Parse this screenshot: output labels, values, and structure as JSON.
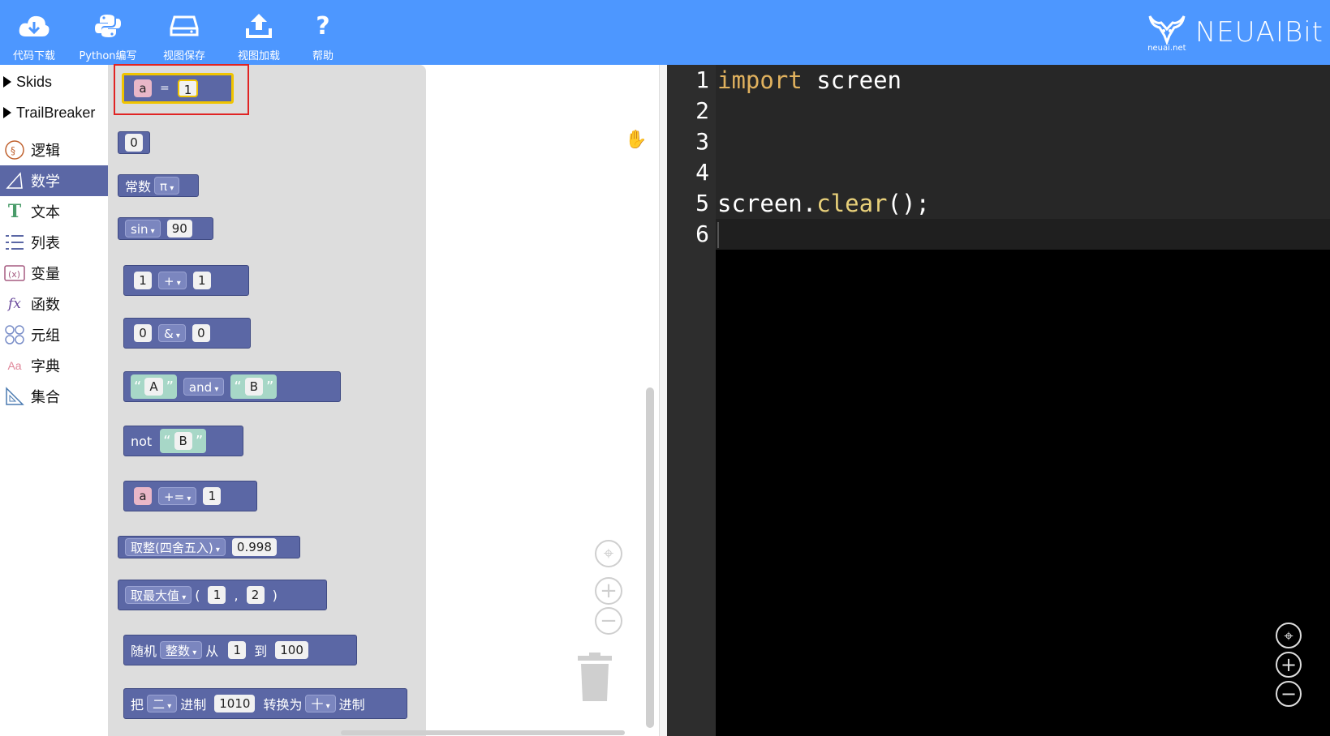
{
  "toolbar": {
    "buttons": [
      {
        "label": "代码下载",
        "icon": "cloud-download-icon"
      },
      {
        "label": "Python编写",
        "icon": "python-icon"
      },
      {
        "label": "视图保存",
        "icon": "drive-icon"
      },
      {
        "label": "视图加载",
        "icon": "upload-icon"
      },
      {
        "label": "帮助",
        "icon": "question-icon"
      }
    ],
    "brand_sub": "neuai.net",
    "brand_name": "NEUAIBit"
  },
  "sidebar": {
    "folders": [
      "Skids",
      "TrailBreaker"
    ],
    "categories": [
      {
        "label": "逻辑",
        "icon": "logic-icon"
      },
      {
        "label": "数学",
        "icon": "math-icon",
        "selected": true
      },
      {
        "label": "文本",
        "icon": "text-icon"
      },
      {
        "label": "列表",
        "icon": "list-icon"
      },
      {
        "label": "变量",
        "icon": "variable-icon"
      },
      {
        "label": "函数",
        "icon": "function-icon"
      },
      {
        "label": "元组",
        "icon": "tuple-icon"
      },
      {
        "label": "字典",
        "icon": "dict-icon"
      },
      {
        "label": "集合",
        "icon": "set-icon"
      }
    ]
  },
  "blocks": {
    "assign": {
      "var": "a",
      "op": "=",
      "val": "1"
    },
    "number": "0",
    "constant": {
      "label": "常数",
      "value": "π"
    },
    "trig": {
      "fn": "sin",
      "val": "90"
    },
    "arith": {
      "a": "1",
      "op": "+",
      "b": "1"
    },
    "bitwise": {
      "a": "0",
      "op": "&",
      "b": "0"
    },
    "logic": {
      "a": "A",
      "op": "and",
      "b": "B",
      "ql": "“",
      "qr": "”"
    },
    "not": {
      "label": "not",
      "val": "B"
    },
    "augassign": {
      "var": "a",
      "op": "+=",
      "val": "1"
    },
    "round": {
      "fn": "取整(四舍五入)",
      "val": "0.998"
    },
    "max": {
      "fn": "取最大值",
      "a": "1",
      "b": "2",
      "lp": "(",
      "comma": ",",
      "rp": ")"
    },
    "random": {
      "label": "随机",
      "type": "整数",
      "from": "从",
      "a": "1",
      "to": "到",
      "b": "100"
    },
    "convert": {
      "label1": "把",
      "base1": "二",
      "label2": "进制",
      "val": "1010",
      "label3": "转换为",
      "base2": "十",
      "label4": "进制"
    }
  },
  "editor": {
    "line_numbers": [
      "1",
      "2",
      "3",
      "4",
      "5",
      "6"
    ],
    "line1_kw": "import",
    "line1_rest": " screen",
    "line5_obj": "screen.",
    "line5_fn": "clear",
    "line5_rest": "();"
  },
  "zoom": {
    "center": "⌖",
    "plus": "+",
    "minus": "−"
  }
}
